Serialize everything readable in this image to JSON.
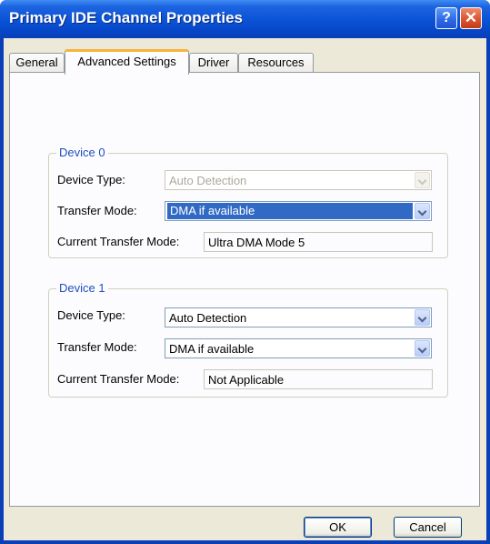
{
  "window": {
    "title": "Primary IDE Channel Properties",
    "help_glyph": "?",
    "close_glyph": "✕"
  },
  "tabs": [
    {
      "label": "General",
      "active": false
    },
    {
      "label": "Advanced Settings",
      "active": true
    },
    {
      "label": "Driver",
      "active": false
    },
    {
      "label": "Resources",
      "active": false
    }
  ],
  "device0": {
    "title": "Device 0",
    "device_type_label": "Device Type:",
    "device_type_value": "Auto Detection",
    "device_type_enabled": false,
    "transfer_mode_label": "Transfer Mode:",
    "transfer_mode_value": "DMA if available",
    "current_mode_label": "Current Transfer Mode:",
    "current_mode_value": "Ultra DMA Mode 5"
  },
  "device1": {
    "title": "Device 1",
    "device_type_label": "Device Type:",
    "device_type_value": "Auto Detection",
    "transfer_mode_label": "Transfer Mode:",
    "transfer_mode_value": "DMA if available",
    "current_mode_label": "Current Transfer Mode:",
    "current_mode_value": "Not Applicable"
  },
  "buttons": {
    "ok": "OK",
    "cancel": "Cancel"
  },
  "icons": {
    "help": "help-icon",
    "close": "close-icon",
    "dropdown": "chevron-down-icon"
  },
  "colors": {
    "title_bar": "#0a52d6",
    "close_button": "#d95530",
    "active_tab_accent": "#f7b43b",
    "selection": "#316ac5",
    "group_label": "#1f4fc0"
  }
}
